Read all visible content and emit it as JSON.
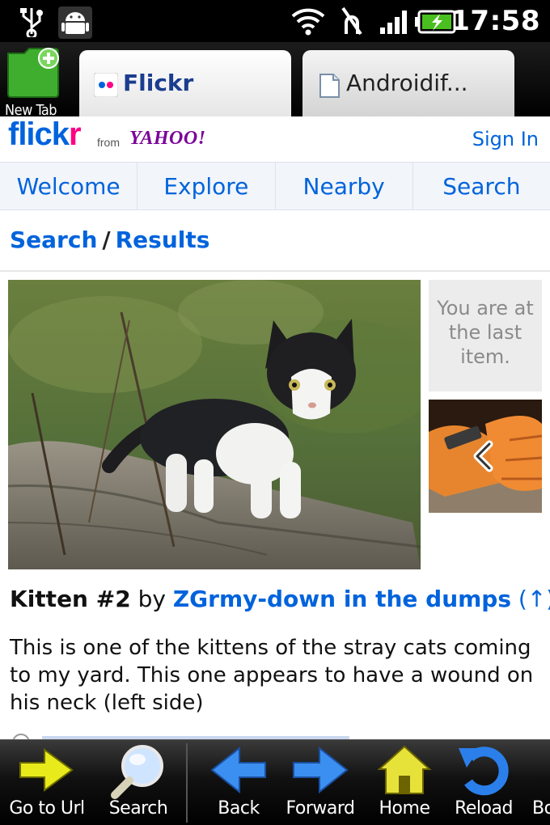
{
  "status_bar": {
    "time": "17:58",
    "icons": [
      "usb-icon",
      "android-debug-icon",
      "wifi-icon",
      "no-sim-icon",
      "signal-icon",
      "battery-charging-icon"
    ]
  },
  "tabs": {
    "new_tab_label": "New Tab",
    "items": [
      {
        "label": "Flickr",
        "icon": "flickr-favicon",
        "active": true
      },
      {
        "label": "Androidif...",
        "icon": "page-icon",
        "active": false
      }
    ]
  },
  "flickr": {
    "logo_flick": "flick",
    "logo_r": "r",
    "from": "from",
    "yahoo": "YAHOO!",
    "sign_in": "Sign In",
    "nav": [
      "Welcome",
      "Explore",
      "Nearby",
      "Search"
    ],
    "breadcrumb": {
      "search": "Search",
      "separator": "/",
      "results": "Results"
    },
    "last_item_note": "You are at the last item.",
    "photo": {
      "title": "Kitten #2",
      "by": "by",
      "author": "ZGrmy-down in the dumps",
      "up_link": "(↑)",
      "description": "This is one of the kittens of the stray cats coming to my yard. This one appears to have a wound on his neck (left side)"
    },
    "colors": {
      "blue": "#0063dc",
      "pink": "#ff0084",
      "yahoo_purple": "#7b0099"
    }
  },
  "toolbar": {
    "buttons": [
      {
        "label": "Go to Url",
        "icon": "go-arrow-icon"
      },
      {
        "label": "Search",
        "icon": "magnifier-icon"
      },
      {
        "label": "Back",
        "icon": "back-arrow-icon"
      },
      {
        "label": "Forward",
        "icon": "forward-arrow-icon"
      },
      {
        "label": "Home",
        "icon": "home-icon"
      },
      {
        "label": "Reload",
        "icon": "reload-icon"
      },
      {
        "label": "Bo",
        "icon": "bookmarks-icon"
      }
    ]
  }
}
